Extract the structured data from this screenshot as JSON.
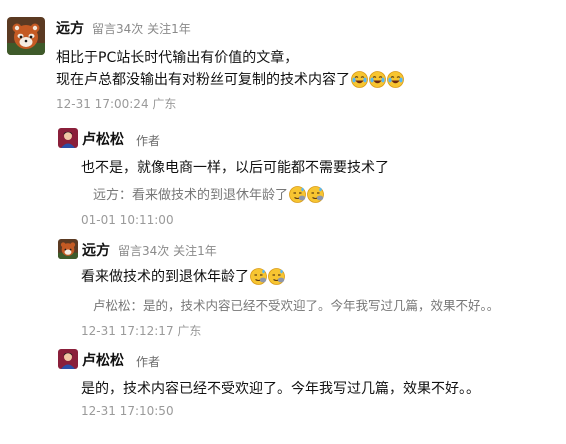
{
  "comments": [
    {
      "user": "远方",
      "meta": "留言34次 关注1年",
      "line1": "相比于PC站长时代输出有价值的文章，",
      "line2": "现在卢总都没输出有对粉丝可复制的技术内容了",
      "emoji": [
        "laugh-cry",
        "laugh-cry",
        "laugh-cry"
      ],
      "time": "12-31 17:00:24 广东"
    },
    {
      "user": "卢松松",
      "tag": "作者",
      "text": "也不是，就像电商一样，以后可能都不需要技术了",
      "quote": "远方：看来做技术的到退休年龄了",
      "quote_emoji": [
        "wipe-sweat",
        "wipe-sweat"
      ],
      "time": "01-01 10:11:00"
    },
    {
      "user": "远方",
      "meta": "留言34次 关注1年",
      "text": "看来做技术的到退休年龄了",
      "text_emoji": [
        "wipe-sweat",
        "wipe-sweat"
      ],
      "quote": "卢松松：是的，技术内容已经不受欢迎了。今年我写过几篇，效果不好。。",
      "time": "12-31 17:12:17 广东"
    },
    {
      "user": "卢松松",
      "tag": "作者",
      "text": "是的，技术内容已经不受欢迎了。今年我写过几篇，效果不好。。",
      "time": "12-31 17:10:50"
    }
  ]
}
